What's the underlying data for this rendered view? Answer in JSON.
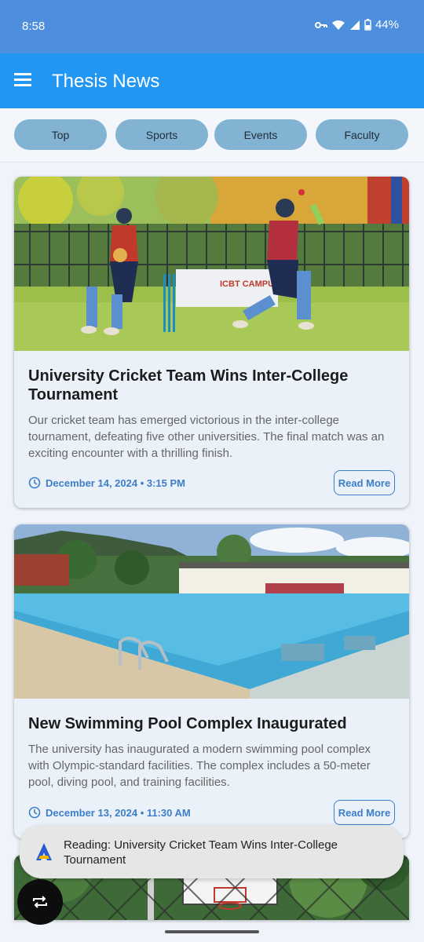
{
  "status": {
    "time": "8:58",
    "battery": "44%"
  },
  "app": {
    "title": "Thesis News"
  },
  "tabs": [
    {
      "label": "Top"
    },
    {
      "label": "Sports"
    },
    {
      "label": "Events"
    },
    {
      "label": "Faculty"
    }
  ],
  "articles": [
    {
      "title": "University Cricket Team Wins Inter-College Tournament",
      "summary": "Our cricket team has emerged victorious in the inter-college tournament, defeating five other universities. The final match was an exciting encounter with a thrilling finish.",
      "date": "December 14, 2024 • 3:15 PM",
      "read_more": "Read More",
      "image_sign": "ICBT CAMPUS"
    },
    {
      "title": "New Swimming Pool Complex Inaugurated",
      "summary": "The university has inaugurated a modern swimming pool complex with Olympic-standard facilities. The complex includes a 50-meter pool, diving pool, and training facilities.",
      "date": "December 13, 2024 • 11:30 AM",
      "read_more": "Read More"
    }
  ],
  "toast": {
    "text": "Reading: University Cricket Team Wins Inter-College Tournament"
  },
  "colors": {
    "app_bar": "#2196f3",
    "status_bar": "#4d8fdc",
    "tab_bg": "#83b3d3",
    "accent": "#3d7ec9"
  }
}
